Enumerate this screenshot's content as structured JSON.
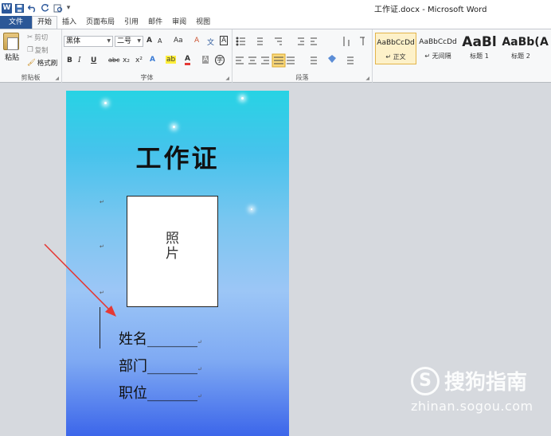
{
  "window": {
    "title": "工作证.docx - Microsoft Word"
  },
  "qat": {
    "app_icon": "W",
    "save_icon": "save-icon",
    "undo_icon": "undo-icon",
    "redo_icon": "redo-icon",
    "customize": "▾"
  },
  "tabs": [
    {
      "label": "文件"
    },
    {
      "label": "开始"
    },
    {
      "label": "插入"
    },
    {
      "label": "页面布局"
    },
    {
      "label": "引用"
    },
    {
      "label": "邮件"
    },
    {
      "label": "审阅"
    },
    {
      "label": "视图"
    }
  ],
  "ribbon": {
    "clipboard": {
      "paste": "粘贴",
      "cut": "剪切",
      "copy": "复制",
      "format_painter": "格式刷",
      "group_label": "剪贴板"
    },
    "font": {
      "font_name": "黑体",
      "font_size": "二号",
      "group_label": "字体",
      "grow": "A",
      "shrink": "A",
      "change_case": "Aa",
      "clear": "A",
      "bold": "B",
      "italic": "I",
      "underline": "U",
      "strike": "abc",
      "subscript": "x₂",
      "superscript": "x²",
      "text_effect": "A",
      "highlight": "ab",
      "font_color": "A",
      "char_shading": "A",
      "enclose": "字"
    },
    "paragraph": {
      "group_label": "段落"
    },
    "styles": [
      {
        "sample": "AaBbCcDd",
        "name": "正文"
      },
      {
        "sample": "AaBbCcDd",
        "name": "无间隔"
      },
      {
        "sample": "AaBl",
        "name": "标题 1"
      },
      {
        "sample": "AaBb(",
        "name": "标题 2"
      },
      {
        "sample": "A",
        "name": ""
      }
    ]
  },
  "document": {
    "title": "工作证",
    "photo_line1": "照",
    "photo_line2": "片",
    "fields": [
      {
        "label": "姓名",
        "blank": "_______"
      },
      {
        "label": "部门",
        "blank": "_______"
      },
      {
        "label": "职位",
        "blank": "_______"
      }
    ],
    "para_mark": "↵"
  },
  "colors": {
    "file_tab": "#2b5797",
    "arrow": "#e53935",
    "accent": "#e3b44a"
  },
  "watermark": {
    "brand": "搜狗指南",
    "url": "zhinan.sogou.com"
  }
}
